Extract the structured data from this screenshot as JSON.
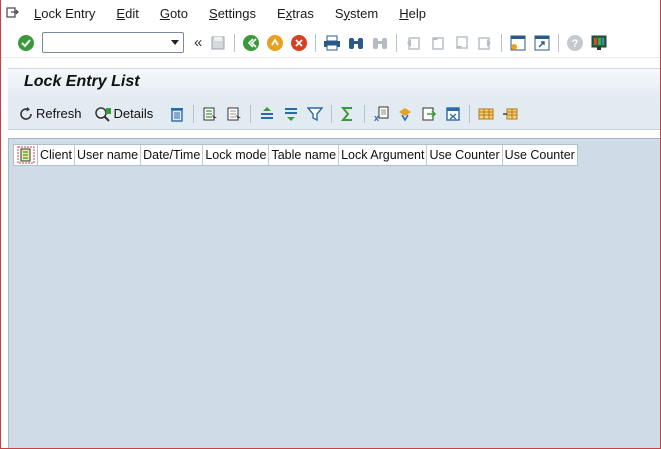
{
  "menu": {
    "items": [
      {
        "label": "Lock Entry",
        "underline": "L"
      },
      {
        "label": "Edit",
        "underline": "E"
      },
      {
        "label": "Goto",
        "underline": "G"
      },
      {
        "label": "Settings",
        "underline": "S"
      },
      {
        "label": "Extras",
        "underline": "x"
      },
      {
        "label": "System",
        "underline": "y"
      },
      {
        "label": "Help",
        "underline": "H"
      }
    ]
  },
  "toolbar": {
    "command_value": "",
    "chevron": "«"
  },
  "page": {
    "title": "Lock Entry List"
  },
  "app_toolbar": {
    "refresh_label": "Refresh",
    "details_label": "Details"
  },
  "grid": {
    "columns": [
      "Client",
      "User name",
      "Date/Time",
      "Lock mode",
      "Table name",
      "Lock Argument",
      "Use Counter",
      "Use Counter"
    ],
    "rows": []
  },
  "colors": {
    "title_bg": "#e3ebf2",
    "grid_bg": "#cfdbe6",
    "frame": "#c94040"
  }
}
